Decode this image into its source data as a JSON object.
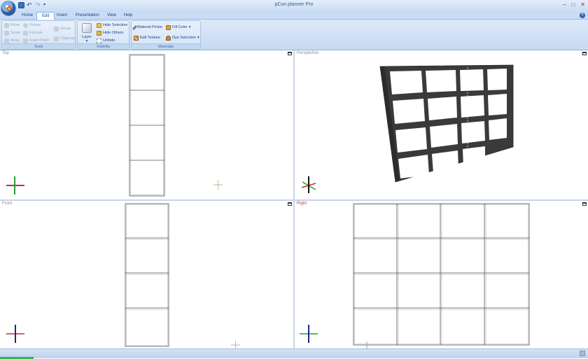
{
  "window": {
    "title": "pCon.planner Pro",
    "minimize": "–",
    "maximize": "□",
    "close": "✕"
  },
  "quick_access": {
    "more": "▾"
  },
  "tabs": [
    {
      "label": "Home",
      "active": false
    },
    {
      "label": "Edit",
      "active": true
    },
    {
      "label": "Insert",
      "active": false
    },
    {
      "label": "Presentation",
      "active": false
    },
    {
      "label": "View",
      "active": false
    },
    {
      "label": "Help",
      "active": false
    }
  ],
  "ribbon": {
    "tools": {
      "label": "Tools",
      "move": "Move",
      "rotate": "Rotate",
      "scale": "Scale",
      "extrude": "Extrude",
      "array": "Array",
      "insert_point": "Insert Point",
      "group": "Group",
      "ungroup": "Ungroup"
    },
    "visibility": {
      "label": "Visibility",
      "layer": "Layer",
      "layer_arrow": "▾",
      "hide_selection": "Hide Selection",
      "hide_others": "Hide Others",
      "unhide": "Unhide"
    },
    "materials": {
      "label": "Materials",
      "material_picker": "Material Picker",
      "fill_color": "Fill Color",
      "edit_texture": "Edit Texture",
      "dye_selection": "Dye Selection",
      "dropdown_arrow": "▾"
    }
  },
  "viewports": {
    "top": {
      "label": "Top"
    },
    "perspective": {
      "label": "Perspective"
    },
    "front": {
      "label": "Front"
    },
    "right": {
      "label": "Right",
      "active": true
    }
  },
  "colors": {
    "accent": "#15428b",
    "active_viewport_label": "#d03a3a",
    "shelf_dark": "#3a3a3a",
    "axis_x": "#c03030",
    "axis_y": "#2e9a3a",
    "axis_z": "#1a2a80"
  },
  "icons": [
    "app-orb-icon",
    "save-icon",
    "undo-icon",
    "redo-icon",
    "help-icon",
    "move-icon",
    "rotate-icon",
    "scale-icon",
    "extrude-icon",
    "array-icon",
    "insert-point-icon",
    "group-icon",
    "ungroup-icon",
    "layer-icon",
    "hide-selection-icon",
    "hide-others-icon",
    "unhide-icon",
    "material-picker-icon",
    "fill-color-icon",
    "edit-texture-icon",
    "dye-selection-icon",
    "maximize-viewport-icon"
  ]
}
